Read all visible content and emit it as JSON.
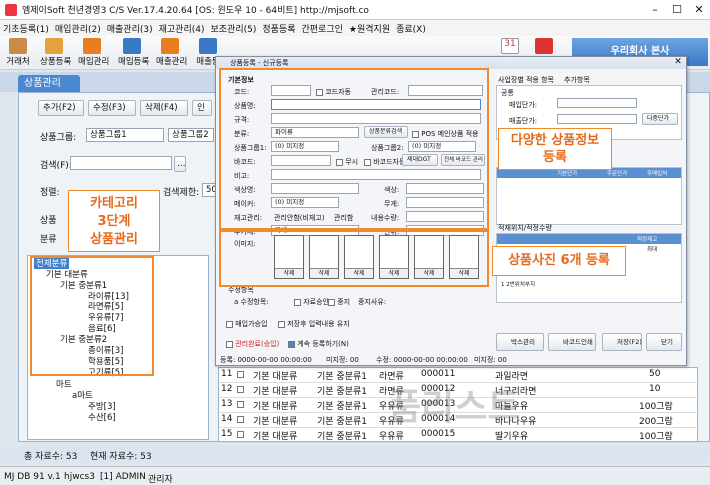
{
  "window": {
    "title": "엠제이Soft 천년경영3 C/S   Ver.17.4.20.64   [OS: 윈도우 10 - 64비트]   http://mjsoft.co"
  },
  "menu": [
    "기초등록(1)",
    "매입관리(2)",
    "매출관리(3)",
    "재고관리(4)",
    "보조관리(5)",
    "정품등록",
    "간편로그인",
    "★원격지원",
    "종료(X)"
  ],
  "toolbar": [
    "거래처",
    "상품등록",
    "매입관리",
    "매입등록",
    "매출관리",
    "매출등"
  ],
  "banner": "우리회사 본사",
  "tab": "상품관리",
  "actions": {
    "add": "추가(F2)",
    "edit": "수정(F3)",
    "delete": "삭제(F4)",
    "print": "인"
  },
  "filters": {
    "group_label": "상품그룹:",
    "group1": "상품그룹1",
    "group2": "상품그룹2",
    "search_label": "검색(F):",
    "sort_label": "정렬:",
    "limit_label": "검색제한:",
    "limit_value": "50",
    "cat_label": "상품",
    "cat2_label": "분류"
  },
  "tree": {
    "root": "전체분류",
    "items": [
      "기본 대분류",
      "기본 중분류1",
      "라이류[13]",
      "라면류[5]",
      "우유류[7]",
      "음료[6]",
      "기본 중분류2",
      "종이류[3]",
      "학용품[5]",
      "고기류[5]",
      "마트",
      "a마트",
      "주방[3]",
      "수산[6]"
    ]
  },
  "grid": {
    "rows": [
      {
        "num": "11",
        "c1": "기본 대분류",
        "c2": "기본 중분류1",
        "c3": "라면류",
        "code": "000011",
        "name": "과일라면",
        "price": "50"
      },
      {
        "num": "12",
        "c1": "기본 대분류",
        "c2": "기본 중분류1",
        "c3": "라면류",
        "code": "000012",
        "name": "너구리라면",
        "price": "10"
      },
      {
        "num": "13",
        "c1": "기본 대분류",
        "c2": "기본 중분류1",
        "c3": "우유류",
        "code": "000013",
        "name": "마늘우유",
        "price": "100그람"
      },
      {
        "num": "14",
        "c1": "기본 대분류",
        "c2": "기본 중분류1",
        "c3": "우유류",
        "code": "000014",
        "name": "바나나우유",
        "price": "200그람"
      },
      {
        "num": "15",
        "c1": "기본 대분류",
        "c2": "기본 중분류1",
        "c3": "우유류",
        "code": "000015",
        "name": "딸기우유",
        "price": "100그람"
      }
    ]
  },
  "status": {
    "total": "총 자료수: 53",
    "current": "현재 자료수: 53",
    "db": "MJ DB 91 v.1",
    "user": "hjwcs3",
    "admin": "[1] ADMIN",
    "role": "관리자"
  },
  "dialog": {
    "title": "상품등록 - 신규등록",
    "section": "기본정보",
    "fields": {
      "code": "코드:",
      "auto": "코드자동",
      "mgmt": "관리코드:",
      "name": "상품명:",
      "spec": "규격:",
      "cat": "분류:",
      "cat_value": "파이류",
      "cat_btn": "상품분류검색",
      "pos": "POS 메인상품 적용",
      "group1": "상품그룹1:",
      "group1_val": "(0) 미지정",
      "group2": "상품그룹2:",
      "group2_val": "(0) 미지정",
      "barcode": "바코드:",
      "nodisp": "무시",
      "barcode_auto": "바코드자동",
      "print_label": "제대DGT",
      "print_btn": "전체 바코드 관리",
      "note": "비고:",
      "color": "색상명:",
      "color2": "색상:",
      "maker": "메이커:",
      "maker_val": "(0) 미지정",
      "weight": "무게:",
      "stock": "재고관리:",
      "stock_opt1": "관리안함(비재고)",
      "stock_opt2": "관리함",
      "qty": "내용수량:",
      "tax": "부가세:",
      "tax_val": "과세",
      "unit": "단위:",
      "image": "이미지:",
      "photo_del": "삭제",
      "memo_label": "수정항목",
      "memo2": "a 수정항목:",
      "memo3": "자료승인",
      "memo4": "중지",
      "memo5": "중지사유:",
      "reg_date": "등록: 0000-00-00 00:00:00",
      "mod_date": "미지정: 00",
      "mod2": "수정: 0000-00-00 00:00:00",
      "mod3": "미지정: 00"
    },
    "right": {
      "tab1": "사업장별 적용 항목",
      "tab2": "추가항목",
      "common": "공통",
      "buy": "매입단가:",
      "sell": "매출단가:",
      "sell_btn": "다중단가",
      "grid1_h1": "기본단가",
      "grid1_h2": "주문단가",
      "grid1_h3": "주매입처",
      "grid2_title": "적재위치/적정수량",
      "grid2_h1": "적정재고",
      "grid2_h2": "최대",
      "grid2_row": "1 2번위치부지"
    },
    "bottom": {
      "cb1": "매입가승입",
      "cb2": "저장후 입력내용 유지",
      "cb3": "관리완료(승입)",
      "cb4": "계속 등록하기(N)",
      "btn_box": "박스관리",
      "btn_print": "바코드인쇄",
      "btn_save": "저장(F2)",
      "btn_close": "닫기"
    }
  },
  "callouts": {
    "cat": "카테고리\n3단계\n상품관리",
    "detail": "다양한 상품정보\n등록",
    "photo": "상품사진 6개 등록"
  },
  "watermark": "품리스트",
  "colors": {
    "accent_orange": "#f08a2a",
    "tab_blue": "#4a88d0"
  }
}
